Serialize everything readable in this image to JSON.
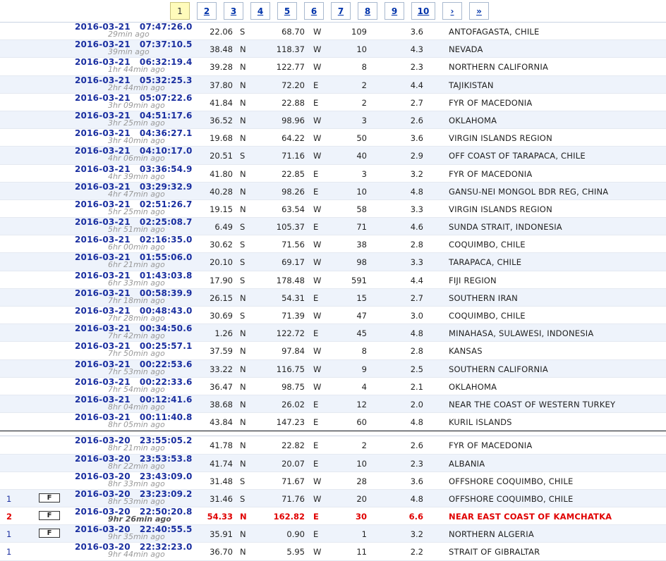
{
  "pagination": {
    "pages": [
      "1",
      "2",
      "3",
      "4",
      "5",
      "6",
      "7",
      "8",
      "9",
      "10"
    ],
    "next": "›",
    "last": "»"
  },
  "rows": [
    {
      "date": "2016-03-21",
      "time": "07:47:26.0",
      "ago": "29min ago",
      "lat": "22.06",
      "ns": "S",
      "lon": "68.70",
      "ew": "W",
      "depth": "109",
      "mag": "3.6",
      "region": "ANTOFAGASTA, CHILE"
    },
    {
      "date": "2016-03-21",
      "time": "07:37:10.5",
      "ago": "39min ago",
      "lat": "38.48",
      "ns": "N",
      "lon": "118.37",
      "ew": "W",
      "depth": "10",
      "mag": "4.3",
      "region": "NEVADA"
    },
    {
      "date": "2016-03-21",
      "time": "06:32:19.4",
      "ago": "1hr 44min ago",
      "lat": "39.28",
      "ns": "N",
      "lon": "122.77",
      "ew": "W",
      "depth": "8",
      "mag": "2.3",
      "region": "NORTHERN CALIFORNIA"
    },
    {
      "date": "2016-03-21",
      "time": "05:32:25.3",
      "ago": "2hr 44min ago",
      "lat": "37.80",
      "ns": "N",
      "lon": "72.20",
      "ew": "E",
      "depth": "2",
      "mag": "4.4",
      "region": "TAJIKISTAN"
    },
    {
      "date": "2016-03-21",
      "time": "05:07:22.6",
      "ago": "3hr 09min ago",
      "lat": "41.84",
      "ns": "N",
      "lon": "22.88",
      "ew": "E",
      "depth": "2",
      "mag": "2.7",
      "region": "FYR OF MACEDONIA"
    },
    {
      "date": "2016-03-21",
      "time": "04:51:17.6",
      "ago": "3hr 25min ago",
      "lat": "36.52",
      "ns": "N",
      "lon": "98.96",
      "ew": "W",
      "depth": "3",
      "mag": "2.6",
      "region": "OKLAHOMA"
    },
    {
      "date": "2016-03-21",
      "time": "04:36:27.1",
      "ago": "3hr 40min ago",
      "lat": "19.68",
      "ns": "N",
      "lon": "64.22",
      "ew": "W",
      "depth": "50",
      "mag": "3.6",
      "region": "VIRGIN ISLANDS REGION"
    },
    {
      "date": "2016-03-21",
      "time": "04:10:17.0",
      "ago": "4hr 06min ago",
      "lat": "20.51",
      "ns": "S",
      "lon": "71.16",
      "ew": "W",
      "depth": "40",
      "mag": "2.9",
      "region": "OFF COAST OF TARAPACA, CHILE"
    },
    {
      "date": "2016-03-21",
      "time": "03:36:54.9",
      "ago": "4hr 39min ago",
      "lat": "41.80",
      "ns": "N",
      "lon": "22.85",
      "ew": "E",
      "depth": "3",
      "mag": "3.2",
      "region": "FYR OF MACEDONIA"
    },
    {
      "date": "2016-03-21",
      "time": "03:29:32.9",
      "ago": "4hr 47min ago",
      "lat": "40.28",
      "ns": "N",
      "lon": "98.26",
      "ew": "E",
      "depth": "10",
      "mag": "4.8",
      "region": "GANSU-NEI MONGOL BDR REG, CHINA"
    },
    {
      "date": "2016-03-21",
      "time": "02:51:26.7",
      "ago": "5hr 25min ago",
      "lat": "19.15",
      "ns": "N",
      "lon": "63.54",
      "ew": "W",
      "depth": "58",
      "mag": "3.3",
      "region": "VIRGIN ISLANDS REGION"
    },
    {
      "date": "2016-03-21",
      "time": "02:25:08.7",
      "ago": "5hr 51min ago",
      "lat": "6.49",
      "ns": "S",
      "lon": "105.37",
      "ew": "E",
      "depth": "71",
      "mag": "4.6",
      "region": "SUNDA STRAIT, INDONESIA"
    },
    {
      "date": "2016-03-21",
      "time": "02:16:35.0",
      "ago": "6hr 00min ago",
      "lat": "30.62",
      "ns": "S",
      "lon": "71.56",
      "ew": "W",
      "depth": "38",
      "mag": "2.8",
      "region": "COQUIMBO, CHILE"
    },
    {
      "date": "2016-03-21",
      "time": "01:55:06.0",
      "ago": "6hr 21min ago",
      "lat": "20.10",
      "ns": "S",
      "lon": "69.17",
      "ew": "W",
      "depth": "98",
      "mag": "3.3",
      "region": "TARAPACA, CHILE"
    },
    {
      "date": "2016-03-21",
      "time": "01:43:03.8",
      "ago": "6hr 33min ago",
      "lat": "17.90",
      "ns": "S",
      "lon": "178.48",
      "ew": "W",
      "depth": "591",
      "mag": "4.4",
      "region": "FIJI REGION"
    },
    {
      "date": "2016-03-21",
      "time": "00:58:39.9",
      "ago": "7hr 18min ago",
      "lat": "26.15",
      "ns": "N",
      "lon": "54.31",
      "ew": "E",
      "depth": "15",
      "mag": "2.7",
      "region": "SOUTHERN IRAN"
    },
    {
      "date": "2016-03-21",
      "time": "00:48:43.0",
      "ago": "7hr 28min ago",
      "lat": "30.69",
      "ns": "S",
      "lon": "71.39",
      "ew": "W",
      "depth": "47",
      "mag": "3.0",
      "region": "COQUIMBO, CHILE"
    },
    {
      "date": "2016-03-21",
      "time": "00:34:50.6",
      "ago": "7hr 42min ago",
      "lat": "1.26",
      "ns": "N",
      "lon": "122.72",
      "ew": "E",
      "depth": "45",
      "mag": "4.8",
      "region": "MINAHASA, SULAWESI, INDONESIA"
    },
    {
      "date": "2016-03-21",
      "time": "00:25:57.1",
      "ago": "7hr 50min ago",
      "lat": "37.59",
      "ns": "N",
      "lon": "97.84",
      "ew": "W",
      "depth": "8",
      "mag": "2.8",
      "region": "KANSAS"
    },
    {
      "date": "2016-03-21",
      "time": "00:22:53.6",
      "ago": "7hr 53min ago",
      "lat": "33.22",
      "ns": "N",
      "lon": "116.75",
      "ew": "W",
      "depth": "9",
      "mag": "2.5",
      "region": "SOUTHERN CALIFORNIA"
    },
    {
      "date": "2016-03-21",
      "time": "00:22:33.6",
      "ago": "7hr 54min ago",
      "lat": "36.47",
      "ns": "N",
      "lon": "98.75",
      "ew": "W",
      "depth": "4",
      "mag": "2.1",
      "region": "OKLAHOMA"
    },
    {
      "date": "2016-03-21",
      "time": "00:12:41.6",
      "ago": "8hr 04min ago",
      "lat": "38.68",
      "ns": "N",
      "lon": "26.02",
      "ew": "E",
      "depth": "12",
      "mag": "2.0",
      "region": "NEAR THE COAST OF WESTERN TURKEY"
    },
    {
      "date": "2016-03-21",
      "time": "00:11:40.8",
      "ago": "8hr 05min ago",
      "lat": "43.84",
      "ns": "N",
      "lon": "147.23",
      "ew": "E",
      "depth": "60",
      "mag": "4.8",
      "region": "KURIL ISLANDS"
    },
    {
      "separator": true
    },
    {
      "date": "2016-03-20",
      "time": "23:55:05.2",
      "ago": "8hr 21min ago",
      "lat": "41.78",
      "ns": "N",
      "lon": "22.82",
      "ew": "E",
      "depth": "2",
      "mag": "2.6",
      "region": "FYR OF MACEDONIA"
    },
    {
      "date": "2016-03-20",
      "time": "23:53:53.8",
      "ago": "8hr 22min ago",
      "lat": "41.74",
      "ns": "N",
      "lon": "20.07",
      "ew": "E",
      "depth": "10",
      "mag": "2.3",
      "region": "ALBANIA"
    },
    {
      "date": "2016-03-20",
      "time": "23:43:09.0",
      "ago": "8hr 33min ago",
      "lat": "31.48",
      "ns": "S",
      "lon": "71.67",
      "ew": "W",
      "depth": "28",
      "mag": "3.6",
      "region": "OFFSHORE COQUIMBO, CHILE"
    },
    {
      "date": "2016-03-20",
      "time": "23:23:09.2",
      "ago": "8hr 53min ago",
      "lat": "31.46",
      "ns": "S",
      "lon": "71.76",
      "ew": "W",
      "depth": "20",
      "mag": "4.8",
      "region": "OFFSHORE COQUIMBO, CHILE",
      "count": "1",
      "felt": "F"
    },
    {
      "date": "2016-03-20",
      "time": "22:50:20.8",
      "ago": "9hr 26min ago",
      "lat": "54.33",
      "ns": "N",
      "lon": "162.82",
      "ew": "E",
      "depth": "30",
      "mag": "6.6",
      "region": "NEAR EAST COAST OF KAMCHATKA",
      "count": "2",
      "felt": "F",
      "highlight": true
    },
    {
      "date": "2016-03-20",
      "time": "22:40:55.5",
      "ago": "9hr 35min ago",
      "lat": "35.91",
      "ns": "N",
      "lon": "0.90",
      "ew": "E",
      "depth": "1",
      "mag": "3.2",
      "region": "NORTHERN ALGERIA",
      "count": "1",
      "felt": "F"
    },
    {
      "date": "2016-03-20",
      "time": "22:32:23.0",
      "ago": "9hr 44min ago",
      "lat": "36.70",
      "ns": "N",
      "lon": "5.95",
      "ew": "W",
      "depth": "11",
      "mag": "2.2",
      "region": "STRAIT OF GIBRALTAR",
      "count": "1"
    }
  ]
}
